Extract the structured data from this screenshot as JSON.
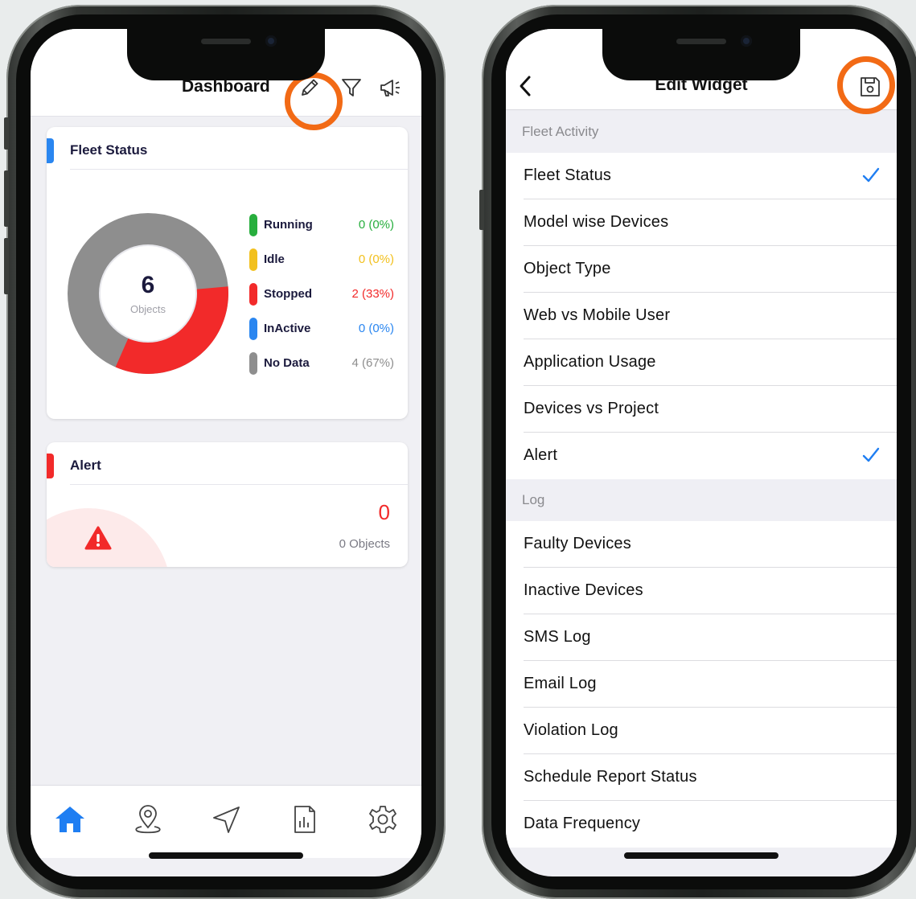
{
  "colors": {
    "accent_orange": "#f26a15",
    "running": "#27ae3d",
    "idle": "#f2c01d",
    "stopped": "#f22a2a",
    "inactive": "#2a86f0",
    "no_data": "#8e8e8e",
    "check_blue": "#1f7ef2"
  },
  "dashboard": {
    "title": "Dashboard",
    "header_icons": [
      "pencil-icon",
      "filter-icon",
      "megaphone-icon"
    ],
    "fleet_card": {
      "title": "Fleet Status",
      "total": "6",
      "total_label": "Objects",
      "legend": [
        {
          "label": "Running",
          "value": "0 (0%)",
          "color": "#27ae3d"
        },
        {
          "label": "Idle",
          "value": "0 (0%)",
          "color": "#f2c01d"
        },
        {
          "label": "Stopped",
          "value": "2 (33%)",
          "color": "#f22a2a"
        },
        {
          "label": "InActive",
          "value": "0 (0%)",
          "color": "#2a86f0"
        },
        {
          "label": "No Data",
          "value": "4 (67%)",
          "color": "#8e8e8e"
        }
      ],
      "donut": {
        "stopped_fraction": 0.33,
        "no_data_fraction": 0.67
      }
    },
    "alert_card": {
      "title": "Alert",
      "count": "0",
      "count_label": "0 Objects"
    },
    "tabs": [
      "home-icon",
      "location-pin-icon",
      "navigation-icon",
      "report-icon",
      "settings-icon"
    ]
  },
  "edit_widget": {
    "title": "Edit Widget",
    "back_icon": "chevron-left-icon",
    "save_icon": "save-icon",
    "sections": [
      {
        "label": "Fleet Activity",
        "items": [
          {
            "label": "Fleet Status",
            "checked": true
          },
          {
            "label": "Model wise Devices",
            "checked": false
          },
          {
            "label": "Object Type",
            "checked": false
          },
          {
            "label": "Web vs Mobile User",
            "checked": false
          },
          {
            "label": "Application Usage",
            "checked": false
          },
          {
            "label": "Devices vs Project",
            "checked": false
          },
          {
            "label": "Alert",
            "checked": true
          }
        ]
      },
      {
        "label": "Log",
        "items": [
          {
            "label": "Faulty Devices",
            "checked": false
          },
          {
            "label": "Inactive Devices",
            "checked": false
          },
          {
            "label": "SMS Log",
            "checked": false
          },
          {
            "label": "Email Log",
            "checked": false
          },
          {
            "label": "Violation Log",
            "checked": false
          },
          {
            "label": "Schedule Report Status",
            "checked": false
          },
          {
            "label": "Data Frequency",
            "checked": false
          }
        ]
      }
    ]
  }
}
